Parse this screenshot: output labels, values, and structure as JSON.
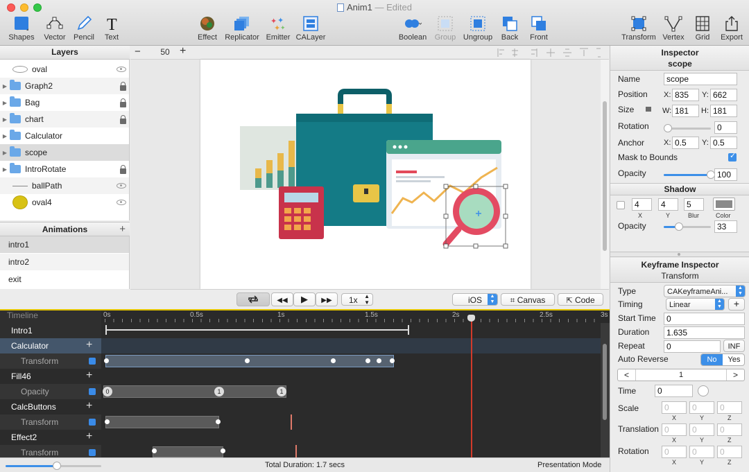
{
  "window": {
    "title": "Anim1",
    "title_status": "— Edited"
  },
  "toolbar": {
    "shapes": "Shapes",
    "vector": "Vector",
    "pencil": "Pencil",
    "text": "Text",
    "effect": "Effect",
    "replicator": "Replicator",
    "emitter": "Emitter",
    "calayer": "CALayer",
    "boolean": "Boolean",
    "group": "Group",
    "ungroup": "Ungroup",
    "back": "Back",
    "front": "Front",
    "transform": "Transform",
    "vertex": "Vertex",
    "grid": "Grid",
    "export": "Export"
  },
  "layers": {
    "title": "Layers",
    "items": [
      {
        "name": "oval"
      },
      {
        "name": "Graph2"
      },
      {
        "name": "Bag"
      },
      {
        "name": "chart"
      },
      {
        "name": "Calculator"
      },
      {
        "name": "scope"
      },
      {
        "name": "IntroRotate"
      },
      {
        "name": "ballPath"
      },
      {
        "name": "oval4"
      }
    ]
  },
  "animations": {
    "title": "Animations",
    "items": [
      "intro1",
      "intro2",
      "exit"
    ]
  },
  "canvas": {
    "zoom_minus": "−",
    "zoom": "50",
    "zoom_plus": "+"
  },
  "playback": {
    "rate": "1x",
    "platform": "iOS",
    "canvas_btn": "Canvas",
    "code_btn": "Code"
  },
  "inspector": {
    "title": "Inspector",
    "layer_name": "scope",
    "name_label": "Name",
    "name_value": "scope",
    "position_label": "Position",
    "x_label": "X:",
    "y_label": "Y:",
    "pos_x": "835",
    "pos_y": "662",
    "size_label": "Size",
    "w_label": "W:",
    "h_label": "H:",
    "size_w": "181",
    "size_h": "181",
    "rotation_label": "Rotation",
    "rotation_value": "0",
    "anchor_label": "Anchor",
    "anchor_x": "0.5",
    "anchor_y": "0.5",
    "mask_label": "Mask to Bounds",
    "opacity_label": "Opacity",
    "opacity_value": "100",
    "opacity_fraction": 1.0,
    "shadow_title": "Shadow",
    "shadow_x": "4",
    "shadow_y": "4",
    "shadow_blur": "5",
    "shadow_x_label": "X",
    "shadow_y_label": "Y",
    "shadow_blur_label": "Blur",
    "shadow_color_label": "Color",
    "shadow_opacity_label": "Opacity",
    "shadow_opacity_value": "33",
    "shadow_opacity_fraction": 0.33
  },
  "keyframe": {
    "title": "Keyframe Inspector",
    "subtitle": "Transform",
    "type_label": "Type",
    "type_value": "CAKeyframeAni...",
    "timing_label": "Timing",
    "timing_value": "Linear",
    "start_label": "Start Time",
    "start_value": "0",
    "duration_label": "Duration",
    "duration_value": "1.635",
    "repeat_label": "Repeat",
    "repeat_value": "0",
    "inf_label": "INF",
    "autoreverse_label": "Auto Reverse",
    "no_label": "No",
    "yes_label": "Yes",
    "prev": "<",
    "index": "1",
    "next": ">",
    "time_label": "Time",
    "time_value": "0",
    "scale_label": "Scale",
    "translation_label": "Translation",
    "rotation_label": "Rotation",
    "placeholder": "0",
    "x": "X",
    "y": "Y",
    "z": "Z"
  },
  "timeline": {
    "header": "Timeline",
    "ticks": [
      "0s",
      "0.5s",
      "1s",
      "1.5s",
      "2s",
      "2.5s",
      "3s"
    ],
    "rows": [
      {
        "name": "Intro1",
        "type": "group"
      },
      {
        "name": "Calculator",
        "type": "layer"
      },
      {
        "name": "Transform",
        "type": "prop"
      },
      {
        "name": "Fill46",
        "type": "layer"
      },
      {
        "name": "Opacity",
        "type": "prop"
      },
      {
        "name": "CalcButtons",
        "type": "layer"
      },
      {
        "name": "Transform",
        "type": "prop"
      },
      {
        "name": "Effect2",
        "type": "layer"
      },
      {
        "name": "Transform",
        "type": "prop"
      }
    ],
    "opacity_kf_labels": [
      "0",
      "1",
      "1"
    ],
    "total_duration": "Total Duration: 1.7 secs",
    "presentation": "Presentation Mode"
  },
  "colors": {
    "accent": "#3c8fe8",
    "teal": "#127f89",
    "bag": "#147b86",
    "red": "#e24a5a",
    "gold": "#e8c547"
  }
}
